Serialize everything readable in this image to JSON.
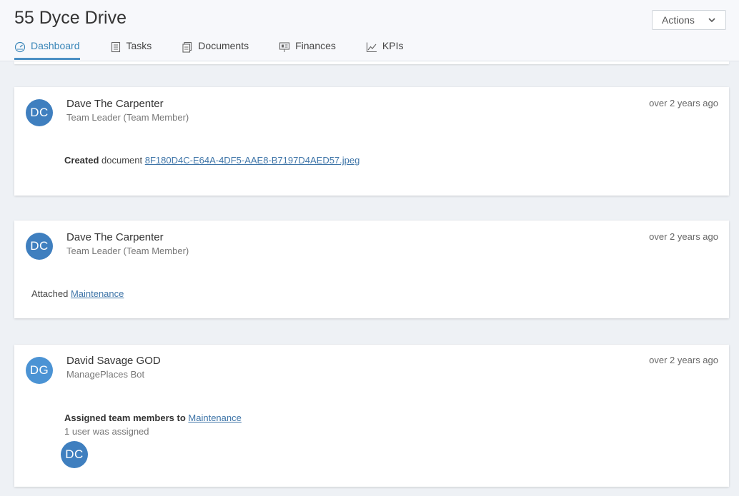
{
  "header": {
    "title": "55 Dyce Drive",
    "actions_label": "Actions"
  },
  "tabs": [
    {
      "label": "Dashboard",
      "icon": "dashboard-icon",
      "active": true
    },
    {
      "label": "Tasks",
      "icon": "tasks-icon"
    },
    {
      "label": "Documents",
      "icon": "documents-icon"
    },
    {
      "label": "Finances",
      "icon": "finances-icon"
    },
    {
      "label": "KPIs",
      "icon": "kpis-icon"
    }
  ],
  "feed": [
    {
      "initials": "DC",
      "name": "Dave The Carpenter",
      "role": "Team Leader (Team Member)",
      "time": "over 2 years ago",
      "action_bold": "Created",
      "action_text": " document ",
      "link": "8F180D4C-E64A-4DF5-AAE8-B7197D4AED57.jpeg"
    },
    {
      "initials": "DC",
      "name": "Dave The Carpenter",
      "role": "Team Leader (Team Member)",
      "time": "over 2 years ago",
      "action_text": "Attached ",
      "link": "Maintenance"
    },
    {
      "initials": "DG",
      "name": "David Savage GOD",
      "role": "ManagePlaces Bot",
      "time": "over 2 years ago",
      "action_bold": "Assigned team members to",
      "link": "Maintenance",
      "detail": "1 user was assigned",
      "assigned_initials": "DC"
    }
  ],
  "colors": {
    "accent": "#4a8fc4",
    "avatar_blue": "#3f7fbf",
    "avatar_light": "#4b93d4",
    "link": "#3f75a8",
    "background": "#eef1f5"
  }
}
